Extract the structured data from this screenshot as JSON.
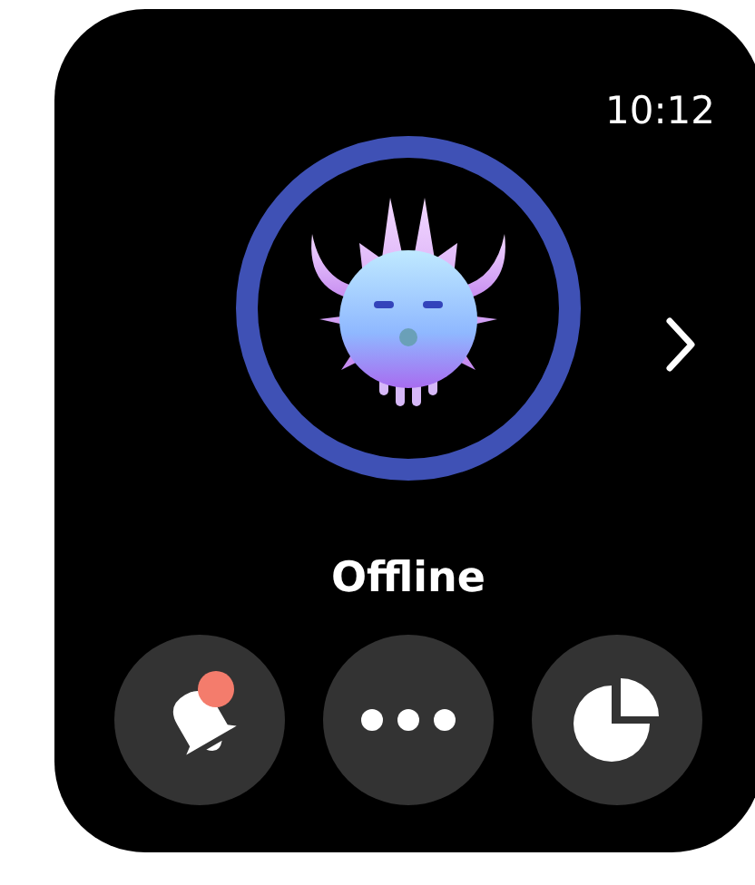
{
  "status_bar": {
    "time": "10:12"
  },
  "status_label": "Offline",
  "buttons": [
    {
      "kind": "notifications",
      "badge": true
    },
    {
      "kind": "more"
    },
    {
      "kind": "stats"
    }
  ]
}
